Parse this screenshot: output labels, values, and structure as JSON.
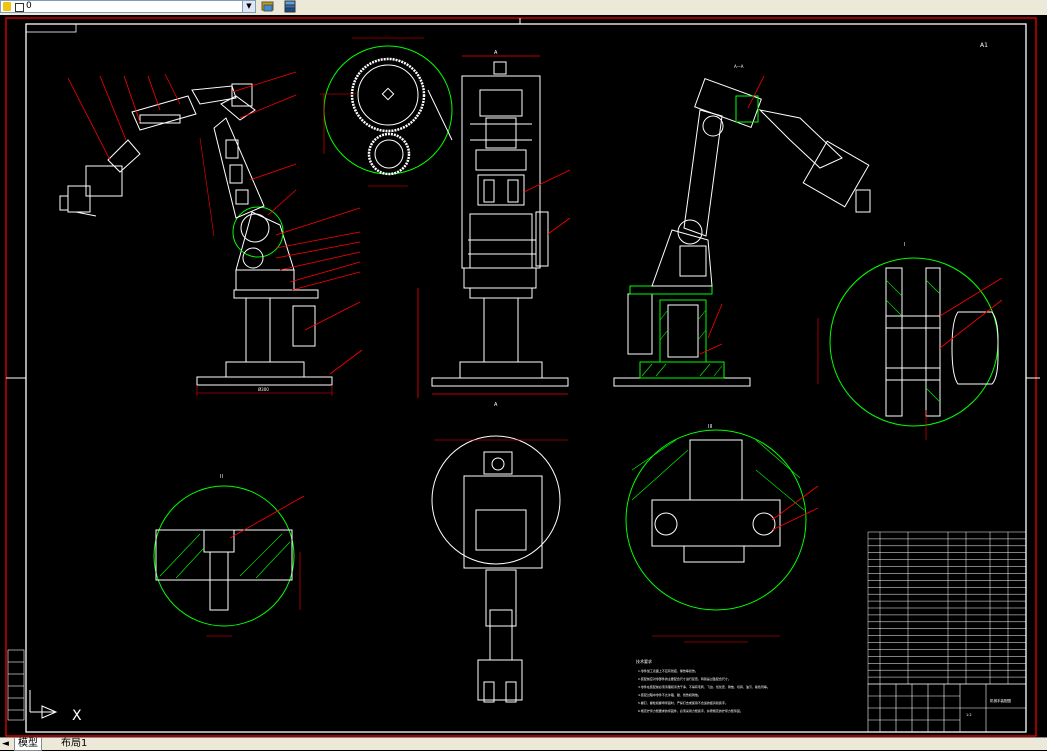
{
  "toolbar": {
    "layer_value": "0",
    "layer_dropdown_arrow": "▼",
    "match_layer_icon": "layer-match-icon",
    "layer_states_icon": "layer-states-icon"
  },
  "tabs": {
    "nav": "◄",
    "model_label": "模型",
    "layout_label": "布局1"
  },
  "drawing": {
    "colors": {
      "background": "#000000",
      "line": "#ffffff",
      "leader": "#ff0000",
      "hatch": "#00ff00",
      "border": "#ff0000"
    },
    "corner_mark": "A1",
    "labels_main": [
      "31",
      "30",
      "29",
      "28",
      "27",
      "1",
      "9",
      "3",
      "8",
      "7",
      "6",
      "5",
      "4",
      "3",
      "2",
      "1"
    ],
    "labels_side": [
      "18",
      "17"
    ],
    "dim_base": "Ø300",
    "dim_side_base": "Ø300",
    "section_top": "A",
    "section_bottom": "A",
    "section_right_title": "A—A",
    "detail_i": "I",
    "detail_ii": "II",
    "detail_iii": "III",
    "detail_iv": "IV",
    "notes_title": "技术要求",
    "notes": [
      "1.零件加工表面上不应有划痕、擦伤等损伤。",
      "2.装配前应对零部件的主要配合尺寸进行复查，特别是过盈配合尺寸。",
      "3.零件在装配前必须清理和清洗干净，不得有毛刺、飞边、氧化皮、锈蚀、切屑、油污、着色剂等。",
      "4.装配过程中零件不允许磕、碰、划伤和锈蚀。",
      "5.螺钉、螺栓和螺母紧固时，严禁打击或使用不合适的旋具和扳手。",
      "6.规定拧紧力矩要求的紧固件，必须采用力矩扳手，并按规定的拧紧力矩紧固。"
    ],
    "title_block_name": "机械手装配图",
    "title_block_scale": "1:2",
    "ucs_x": "X"
  },
  "sidebar_marks": [
    "■",
    "■",
    "■",
    "■",
    "■",
    "■"
  ]
}
